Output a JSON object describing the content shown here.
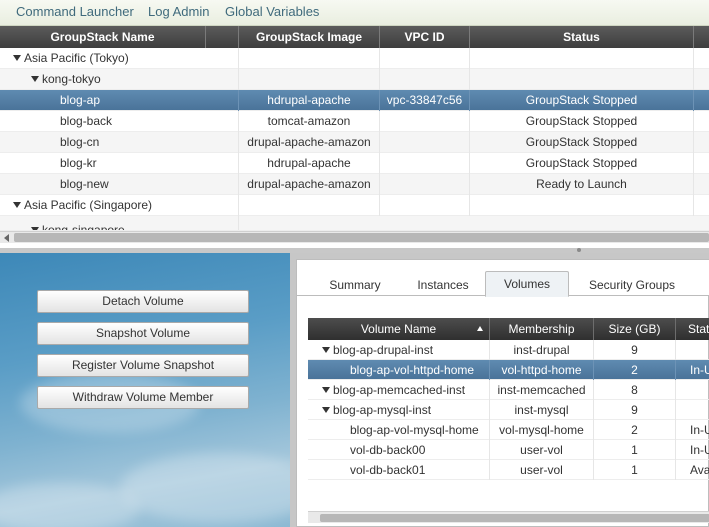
{
  "menu": {
    "items": [
      "Command Launcher",
      "Log Admin",
      "Global Variables"
    ]
  },
  "groupstack_grid": {
    "columns": [
      "GroupStack Name",
      "GroupStack Image",
      "VPC ID",
      "Status"
    ],
    "rows": [
      {
        "name": "Asia Pacific (Tokyo)",
        "image": "",
        "vpc": "",
        "status": ""
      },
      {
        "name": "kong-tokyo",
        "image": "",
        "vpc": "",
        "status": ""
      },
      {
        "name": "blog-ap",
        "image": "hdrupal-apache",
        "vpc": "vpc-33847c56",
        "status": "GroupStack Stopped"
      },
      {
        "name": "blog-back",
        "image": "tomcat-amazon",
        "vpc": "",
        "status": "GroupStack Stopped"
      },
      {
        "name": "blog-cn",
        "image": "drupal-apache-amazon",
        "vpc": "",
        "status": "GroupStack Stopped"
      },
      {
        "name": "blog-kr",
        "image": "hdrupal-apache",
        "vpc": "",
        "status": "GroupStack Stopped"
      },
      {
        "name": "blog-new",
        "image": "drupal-apache-amazon",
        "vpc": "",
        "status": "Ready to Launch"
      },
      {
        "name": "Asia Pacific (Singapore)",
        "image": "",
        "vpc": "",
        "status": ""
      },
      {
        "name": "kong-singapore",
        "image": "",
        "vpc": "",
        "status": ""
      }
    ]
  },
  "actions": {
    "detach": "Detach Volume",
    "snapshot": "Snapshot Volume",
    "register": "Register Volume Snapshot",
    "withdraw": "Withdraw Volume Member"
  },
  "tabs": [
    "Summary",
    "Instances",
    "Volumes",
    "Security Groups"
  ],
  "volume_grid": {
    "columns": [
      "Volume Name",
      "Membership",
      "Size (GB)",
      "Stat"
    ],
    "rows": [
      {
        "name": "blog-ap-drupal-inst",
        "membership": "inst-drupal",
        "size": "9",
        "status": ""
      },
      {
        "name": "blog-ap-vol-httpd-home",
        "membership": "vol-httpd-home",
        "size": "2",
        "status": "In-U"
      },
      {
        "name": "blog-ap-memcached-inst",
        "membership": "inst-memcached",
        "size": "8",
        "status": ""
      },
      {
        "name": "blog-ap-mysql-inst",
        "membership": "inst-mysql",
        "size": "9",
        "status": ""
      },
      {
        "name": "blog-ap-vol-mysql-home",
        "membership": "vol-mysql-home",
        "size": "2",
        "status": "In-U"
      },
      {
        "name": "vol-db-back00",
        "membership": "user-vol",
        "size": "1",
        "status": "In-U"
      },
      {
        "name": "vol-db-back01",
        "membership": "user-vol",
        "size": "1",
        "status": "Avail"
      }
    ]
  }
}
